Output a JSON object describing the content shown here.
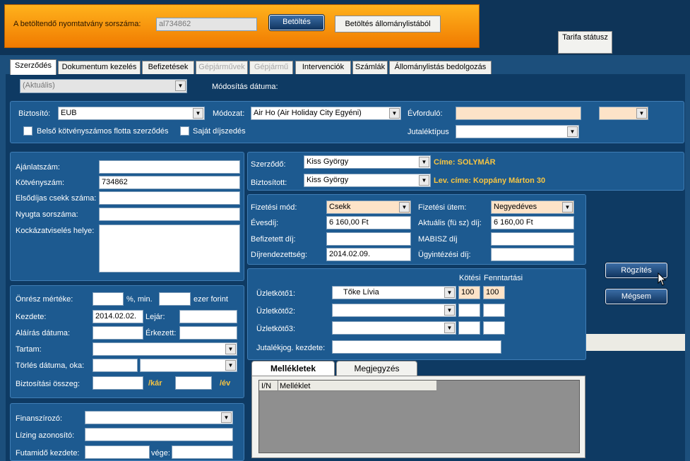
{
  "top": {
    "serial_label": "A betöltendő nyomtatvány sorszáma:",
    "serial_value": "al734862",
    "load_btn": "Betöltés",
    "load_list_btn": "Betöltés állománylistából",
    "tariff_btn": "Tarifa státusz"
  },
  "tabs": [
    {
      "label": "Szerződés"
    },
    {
      "label": "Dokumentum kezelés"
    },
    {
      "label": "Befizetések"
    },
    {
      "label": "Gépjárművek"
    },
    {
      "label": "Gépjármű"
    },
    {
      "label": "Intervenciók"
    },
    {
      "label": "Számlák"
    },
    {
      "label": "Állománylistás bedolgozás"
    }
  ],
  "version": {
    "value": "(Aktuális)",
    "mod_date_label": "Módosítás dátuma:"
  },
  "insurer": {
    "label": "Biztosító:",
    "value": "EUB",
    "mode_label": "Módozat:",
    "mode_value": "Air Ho (Air Holiday City Egyéni)",
    "anniv_label": "Évforduló:",
    "fleet_label": "Belső kötvényszámos flotta szerződés",
    "own_fee_label": "Saját díjszedés",
    "commission_label": "Jutaléktípus"
  },
  "offer": {
    "offer_no_label": "Ajánlatszám:",
    "policy_no_label": "Kötvényszám:",
    "policy_no_value": "734862",
    "cheque_label": "Elsődíjas csekk száma:",
    "receipt_label": "Nyugta sorszáma:",
    "risk_label": "Kockázatviselés helye:"
  },
  "parties": {
    "contractor_label": "Szerződő:",
    "contractor_value": "Kiss György",
    "insured_label": "Biztosított:",
    "insured_value": "Kiss György",
    "address": "Címe: SOLYMÁR",
    "mail_address": "Lev. címe: Koppány Márton 30"
  },
  "payment": {
    "method_label": "Fizetési mód:",
    "method_value": "Csekk",
    "freq_label": "Fizetési ütem:",
    "freq_value": "Negyedéves",
    "annual_label": "Évesdíj:",
    "annual_value": "6 160,00 Ft",
    "current_label": "Aktuális (fü sz) díj:",
    "current_value": "6 160,00 Ft",
    "paid_label": "Befizetett díj:",
    "mabisz_label": "MABISZ díj",
    "due_label": "Díjrendezettség:",
    "due_value": "2014.02.09.",
    "admin_label": "Ügyintézési díj:"
  },
  "dates": {
    "deductible_label": "Önrész mértéke:",
    "pct_label": "%, min.",
    "thousand_label": "ezer forint",
    "start_label": "Kezdete:",
    "start_value": "2014.02.02.",
    "expiry_label": "Lejár:",
    "sign_label": "Aláírás dátuma:",
    "arrived_label": "Érkezett:",
    "duration_label": "Tartam:",
    "cancel_label": "Törlés dátuma, oka:",
    "sum_label": "Biztosítási összeg:",
    "per_claim": "/kár",
    "per_year": "/év"
  },
  "agents": {
    "header_binding": "Kötési",
    "header_maint": "Fenntartási",
    "agent1_label": "Üzletkötő1:",
    "agent1_value": "Tőke Lívia",
    "agent1_bind": "100",
    "agent1_maint": "100",
    "agent2_label": "Üzletkötő2:",
    "agent3_label": "Üzletkötő3:",
    "commission_start_label": "Jutalékjog. kezdete:"
  },
  "actions": {
    "save": "Rögzítés",
    "cancel": "Mégsem"
  },
  "finance": {
    "financer_label": "Finanszírozó:",
    "leasing_label": "Lízing azonosító:",
    "term_start_label": "Futamidő kezdete:",
    "term_end_label": "vége:"
  },
  "attachments": {
    "tab_attachments": "Mellékletek",
    "tab_notes": "Megjegyzés",
    "col_yn": "I/N",
    "col_attachment": "Melléklet"
  },
  "colors": {
    "orange": "#f7960d",
    "navy": "#1c4f7c",
    "gold": "#f7c542",
    "peach": "#fde3c8"
  }
}
